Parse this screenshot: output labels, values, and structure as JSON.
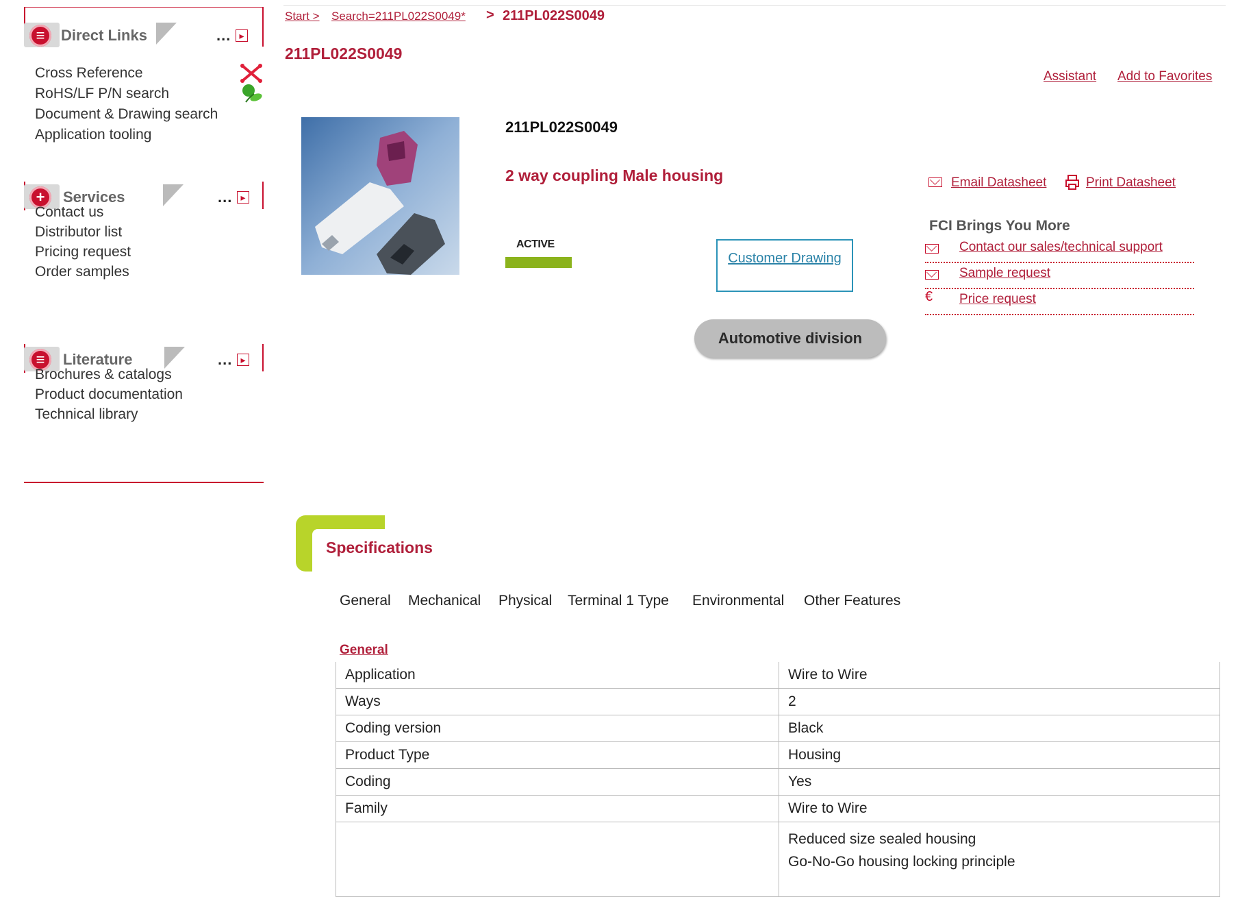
{
  "sidebar": {
    "sections": [
      {
        "title": "Direct Links",
        "items": [
          "Cross Reference",
          "RoHS/LF P/N search",
          "Document & Drawing search",
          "Application tooling"
        ]
      },
      {
        "title": "Services",
        "items": [
          "Contact us",
          "Distributor list",
          "Pricing request",
          "Order samples"
        ]
      },
      {
        "title": "Literature",
        "items": [
          "Brochures & catalogs",
          "Product documentation",
          "Technical library"
        ]
      }
    ],
    "dots": "...",
    "expand_glyph": "▸"
  },
  "breadcrumb": {
    "start": "Start > ",
    "search": "Search=211PL022S0049*",
    "separator": ">",
    "current": "211PL022S0049"
  },
  "page_title": "211PL022S0049",
  "top_links": {
    "assistant": "Assistant",
    "favorites": "Add to Favorites"
  },
  "product": {
    "code": "211PL022S0049",
    "description": "2 way coupling Male housing",
    "status": "ACTIVE",
    "customer_drawing": "Customer Drawing",
    "division": "Automotive division",
    "status_color": "#8bb31c"
  },
  "datasheet": {
    "email": "Email Datasheet",
    "print": "Print Datasheet"
  },
  "fci": {
    "title": "FCI Brings You More",
    "links": [
      "Contact our sales/technical support",
      "Sample request",
      "Price request"
    ],
    "price_icon": "€"
  },
  "specifications": {
    "title": "Specifications",
    "tabs": [
      "General",
      "Mechanical",
      "Physical",
      "Terminal 1 Type",
      "Environmental",
      "Other Features"
    ],
    "section": "General",
    "rows": [
      {
        "label": "Application",
        "value": "Wire to Wire"
      },
      {
        "label": "Ways",
        "value": "2"
      },
      {
        "label": "Coding version",
        "value": "Black"
      },
      {
        "label": "Product Type",
        "value": "Housing"
      },
      {
        "label": "Coding",
        "value": "Yes"
      },
      {
        "label": "Family",
        "value": "Wire to Wire"
      }
    ],
    "features": [
      "Reduced size sealed housing",
      "Go-No-Go housing locking principle"
    ]
  },
  "colors": {
    "brand_red": "#c8102e",
    "link_red": "#b01f3a",
    "spec_green": "#b8d42a",
    "drawing_blue": "#2b93b8"
  }
}
